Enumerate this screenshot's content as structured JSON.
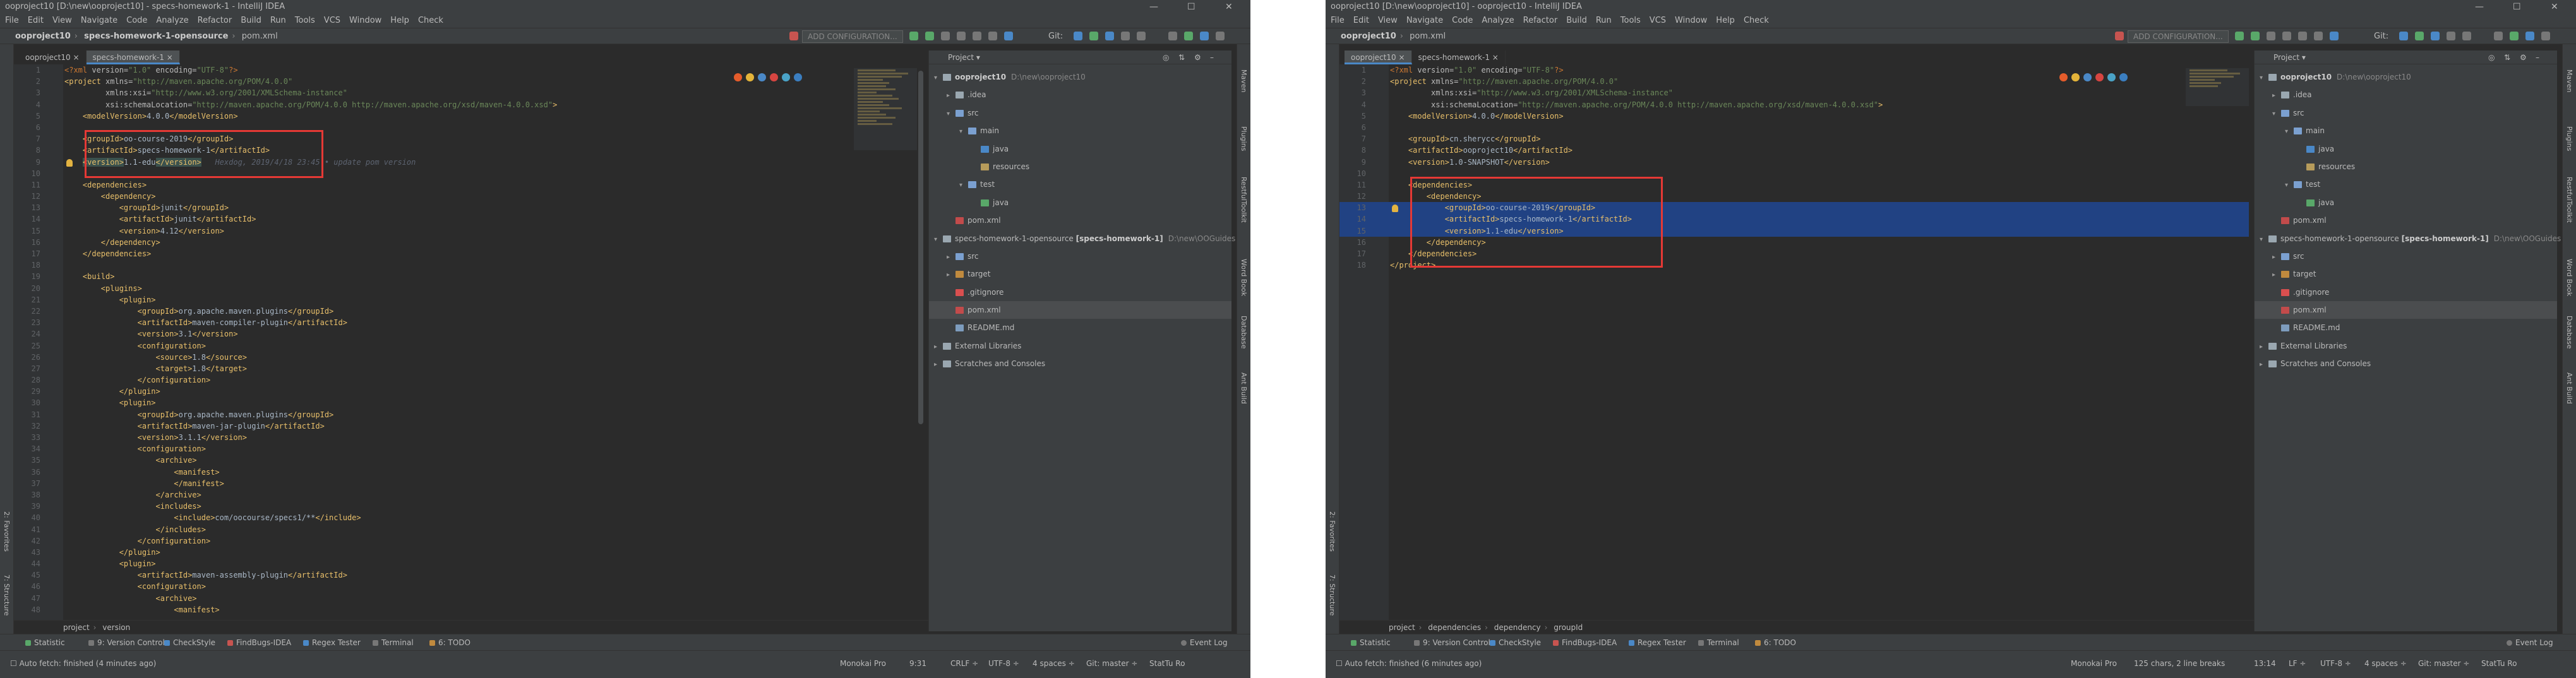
{
  "winA": {
    "title": "ooproject10 [D:\\new\\ooproject10] - specs-homework-1 - IntelliJ IDEA",
    "menu": [
      "File",
      "Edit",
      "View",
      "Navigate",
      "Code",
      "Analyze",
      "Refactor",
      "Build",
      "Run",
      "Tools",
      "VCS",
      "Window",
      "Help",
      "Check"
    ],
    "nav": {
      "root": "ooproject10",
      "module": "specs-homework-1-opensource",
      "file": "pom.xml"
    },
    "run_config": "ADD CONFIGURATION...",
    "git_label": "Git:",
    "tabs": [
      "ooproject10",
      "specs-homework-1"
    ],
    "blame": "Hexdog, 2019/4/18 23:45 • update pom version",
    "breadcrumb": [
      "project",
      "version"
    ],
    "project_title": "Project",
    "tree": [
      {
        "label": "ooproject10",
        "path": "D:\\new\\ooproject10",
        "bold": true
      },
      {
        "label": ".idea"
      },
      {
        "label": "src"
      },
      {
        "label": "main"
      },
      {
        "label": "java"
      },
      {
        "label": "resources"
      },
      {
        "label": "test"
      },
      {
        "label": "java"
      },
      {
        "label": "pom.xml"
      },
      {
        "label": "specs-homework-1-opensource",
        "extra": "[specs-homework-1]",
        "path": "D:\\new\\OOGuides"
      },
      {
        "label": "src"
      },
      {
        "label": "target"
      },
      {
        "label": ".gitignore"
      },
      {
        "label": "pom.xml"
      },
      {
        "label": "README.md"
      },
      {
        "label": "External Libraries"
      },
      {
        "label": "Scratches and Consoles"
      }
    ],
    "bottom_tools": [
      "Statistic",
      "9: Version Control",
      "CheckStyle",
      "FindBugs-IDEA",
      "Regex Tester",
      "Terminal",
      "6: TODO",
      "Event Log"
    ],
    "status_left": "Auto fetch: finished (4 minutes ago)",
    "status_right": {
      "plugin": "Monokai Pro",
      "pos": "9:31",
      "eol": "CRLF ÷",
      "enc": "UTF-8 ÷",
      "indent": "4 spaces ÷",
      "git": "Git: master ÷",
      "mem": "StatTu Ro"
    },
    "left_tools": [
      "1: Project",
      "2: Favorites",
      "7: Structure"
    ],
    "right_tools": [
      "Maven",
      "Plugins",
      "RestfulToolkit",
      "Word Book",
      "Database",
      "Ant Build"
    ]
  },
  "winB": {
    "title": "ooproject10 [D:\\new\\ooproject10] - ooproject10 - IntelliJ IDEA",
    "menu": [
      "File",
      "Edit",
      "View",
      "Navigate",
      "Code",
      "Analyze",
      "Refactor",
      "Build",
      "Run",
      "Tools",
      "VCS",
      "Window",
      "Help",
      "Check"
    ],
    "nav": {
      "root": "ooproject10",
      "file": "pom.xml"
    },
    "run_config": "ADD CONFIGURATION...",
    "git_label": "Git:",
    "tabs": [
      "ooproject10",
      "specs-homework-1"
    ],
    "breadcrumb": [
      "project",
      "dependencies",
      "dependency",
      "groupId"
    ],
    "project_title": "Project",
    "tree": [
      {
        "label": "ooproject10",
        "path": "D:\\new\\ooproject10",
        "bold": true
      },
      {
        "label": ".idea"
      },
      {
        "label": "src"
      },
      {
        "label": "main"
      },
      {
        "label": "java"
      },
      {
        "label": "resources"
      },
      {
        "label": "test"
      },
      {
        "label": "java"
      },
      {
        "label": "pom.xml"
      },
      {
        "label": "specs-homework-1-opensource",
        "extra": "[specs-homework-1]",
        "path": "D:\\new\\OOGuides"
      },
      {
        "label": "src"
      },
      {
        "label": "target"
      },
      {
        "label": ".gitignore"
      },
      {
        "label": "pom.xml"
      },
      {
        "label": "README.md"
      },
      {
        "label": "External Libraries"
      },
      {
        "label": "Scratches and Consoles"
      }
    ],
    "bottom_tools": [
      "Statistic",
      "9: Version Control",
      "CheckStyle",
      "FindBugs-IDEA",
      "Regex Tester",
      "Terminal",
      "6: TODO",
      "Event Log"
    ],
    "status_left": "Auto fetch: finished (6 minutes ago)",
    "status_right": {
      "plugin": "Monokai Pro",
      "sel": "125 chars, 2 line breaks",
      "pos": "13:14",
      "eol": "LF ÷",
      "enc": "UTF-8 ÷",
      "indent": "4 spaces ÷",
      "git": "Git: master ÷",
      "mem": "StatTu Ro"
    },
    "left_tools": [
      "1: Project",
      "2: Favorites",
      "7: Structure"
    ],
    "right_tools": [
      "Maven",
      "Plugins",
      "RestfulToolkit",
      "Word Book",
      "Database",
      "Ant Build"
    ]
  },
  "colors": {
    "bg": "#2b2b2b",
    "panel": "#3c3f41",
    "tag": "#e8bf6a",
    "string": "#6a8759",
    "selection": "#214283",
    "highlight_box": "#e53935",
    "accent": "#4a88c7"
  }
}
